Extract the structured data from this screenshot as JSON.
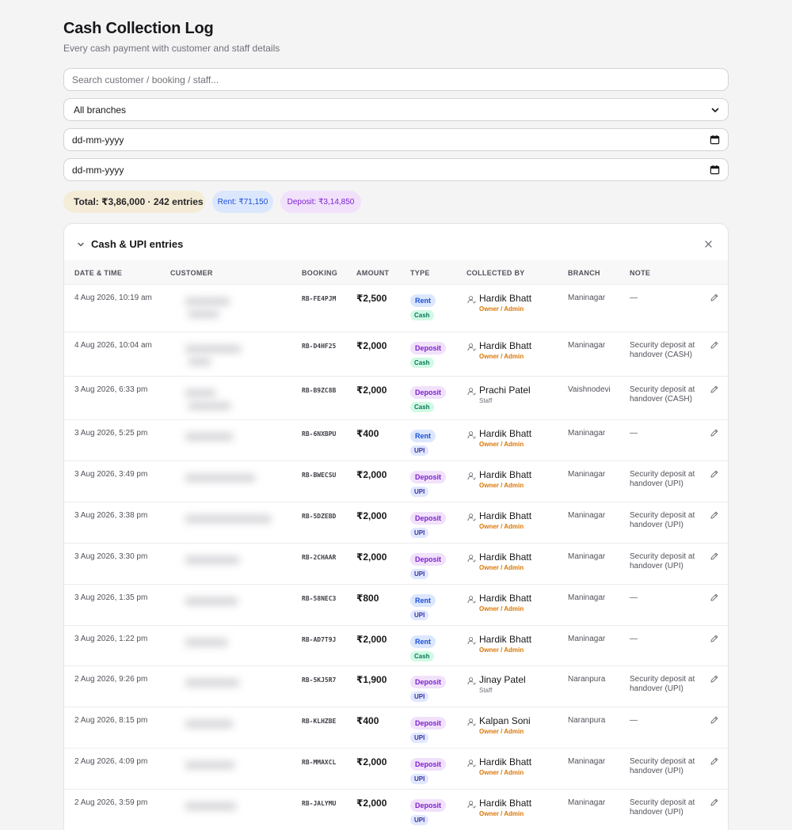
{
  "header": {
    "title": "Cash Collection Log",
    "subtitle": "Every cash payment with customer and staff details"
  },
  "filters": {
    "search_placeholder": "Search customer / booking / staff...",
    "branch_selected": "All branches",
    "date_from_placeholder": "dd-mm-yyyy",
    "date_to_placeholder": "dd-mm-yyyy"
  },
  "summary": {
    "total": "Total: ₹3,86,000 · 242 entries",
    "rent": "Rent: ₹71,150",
    "deposit": "Deposit: ₹3,14,850"
  },
  "table": {
    "title": "Cash & UPI entries",
    "columns": [
      "DATE & TIME",
      "CUSTOMER",
      "BOOKING",
      "AMOUNT",
      "TYPE",
      "COLLECTED BY",
      "BRANCH",
      "NOTE"
    ],
    "rows": [
      {
        "date": "4 Aug 2026, 10:19 am",
        "booking": "RB-FE4PJM",
        "amount": "₹2,500",
        "type": "Rent",
        "method": "Cash",
        "collector": "Hardik Bhatt",
        "role": "Owner / Admin",
        "branch": "Maninagar",
        "note": "—"
      },
      {
        "date": "4 Aug 2026, 10:04 am",
        "booking": "RB-D4HF25",
        "amount": "₹2,000",
        "type": "Deposit",
        "method": "Cash",
        "collector": "Hardik Bhatt",
        "role": "Owner / Admin",
        "branch": "Maninagar",
        "note": "Security deposit at handover (CASH)"
      },
      {
        "date": "3 Aug 2026, 6:33 pm",
        "booking": "RB-B9ZC8B",
        "amount": "₹2,000",
        "type": "Deposit",
        "method": "Cash",
        "collector": "Prachi Patel",
        "role": "Staff",
        "branch": "Vaishnodevi",
        "note": "Security deposit at handover (CASH)"
      },
      {
        "date": "3 Aug 2026, 5:25 pm",
        "booking": "RB-6NXBPU",
        "amount": "₹400",
        "type": "Rent",
        "method": "UPI",
        "collector": "Hardik Bhatt",
        "role": "Owner / Admin",
        "branch": "Maninagar",
        "note": "—"
      },
      {
        "date": "3 Aug 2026, 3:49 pm",
        "booking": "RB-BWECSU",
        "amount": "₹2,000",
        "type": "Deposit",
        "method": "UPI",
        "collector": "Hardik Bhatt",
        "role": "Owner / Admin",
        "branch": "Maninagar",
        "note": "Security deposit at handover (UPI)"
      },
      {
        "date": "3 Aug 2026, 3:38 pm",
        "booking": "RB-5DZEBD",
        "amount": "₹2,000",
        "type": "Deposit",
        "method": "UPI",
        "collector": "Hardik Bhatt",
        "role": "Owner / Admin",
        "branch": "Maninagar",
        "note": "Security deposit at handover (UPI)"
      },
      {
        "date": "3 Aug 2026, 3:30 pm",
        "booking": "RB-2CHAAR",
        "amount": "₹2,000",
        "type": "Deposit",
        "method": "UPI",
        "collector": "Hardik Bhatt",
        "role": "Owner / Admin",
        "branch": "Maninagar",
        "note": "Security deposit at handover (UPI)"
      },
      {
        "date": "3 Aug 2026, 1:35 pm",
        "booking": "RB-58NEC3",
        "amount": "₹800",
        "type": "Rent",
        "method": "UPI",
        "collector": "Hardik Bhatt",
        "role": "Owner / Admin",
        "branch": "Maninagar",
        "note": "—"
      },
      {
        "date": "3 Aug 2026, 1:22 pm",
        "booking": "RB-AD7T9J",
        "amount": "₹2,000",
        "type": "Rent",
        "method": "Cash",
        "collector": "Hardik Bhatt",
        "role": "Owner / Admin",
        "branch": "Maninagar",
        "note": "—"
      },
      {
        "date": "2 Aug 2026, 9:26 pm",
        "booking": "RB-5KJ5R7",
        "amount": "₹1,900",
        "type": "Deposit",
        "method": "UPI",
        "collector": "Jinay Patel",
        "role": "Staff",
        "branch": "Naranpura",
        "note": "Security deposit at handover (UPI)"
      },
      {
        "date": "2 Aug 2026, 8:15 pm",
        "booking": "RB-KLHZBE",
        "amount": "₹400",
        "type": "Deposit",
        "method": "UPI",
        "collector": "Kalpan Soni",
        "role": "Owner / Admin",
        "branch": "Naranpura",
        "note": "—"
      },
      {
        "date": "2 Aug 2026, 4:09 pm",
        "booking": "RB-MMAXCL",
        "amount": "₹2,000",
        "type": "Deposit",
        "method": "UPI",
        "collector": "Hardik Bhatt",
        "role": "Owner / Admin",
        "branch": "Maninagar",
        "note": "Security deposit at handover (UPI)"
      },
      {
        "date": "2 Aug 2026, 3:59 pm",
        "booking": "RB-JALYMU",
        "amount": "₹2,000",
        "type": "Deposit",
        "method": "UPI",
        "collector": "Hardik Bhatt",
        "role": "Owner / Admin",
        "branch": "Maninagar",
        "note": "Security deposit at handover (UPI)"
      }
    ]
  },
  "colors": {
    "rent": "#1d4ed8",
    "deposit": "#7e22ce",
    "cash": "#047857",
    "upi": "#3730a3",
    "admin_role": "#d97706"
  },
  "icons": {
    "collapse": "chevron-down-icon",
    "close": "close-icon",
    "collector": "user-icon",
    "edit": "pencil-icon",
    "date": "calendar-icon"
  }
}
